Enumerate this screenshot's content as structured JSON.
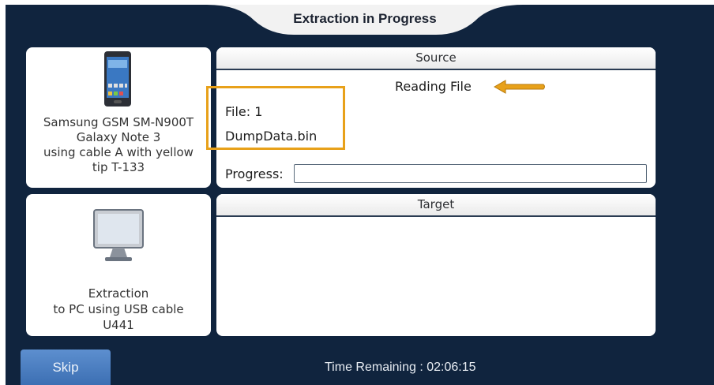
{
  "header": {
    "title": "Extraction in Progress"
  },
  "device": {
    "lines": [
      "Samsung GSM SM-N900T",
      "Galaxy Note 3",
      "using cable A with yellow",
      "tip T-133"
    ],
    "icon": "smartphone-icon"
  },
  "destination": {
    "lines": [
      "Extraction",
      "to PC using USB cable",
      "U441"
    ],
    "icon": "monitor-icon"
  },
  "source": {
    "header": "Source",
    "status": "Reading File",
    "file_label": "File:  1",
    "file_name": "DumpData.bin",
    "progress_label": "Progress:",
    "progress_value": 0,
    "annotation_arrow_icon": "left-arrow-icon",
    "annotation_color": "#e8a11a"
  },
  "target": {
    "header": "Target"
  },
  "footer": {
    "skip_label": "Skip",
    "time_remaining": "Time Remaining : 02:06:15"
  },
  "colors": {
    "background": "#10243e",
    "accent_button": "#4a7dc0",
    "highlight": "#e8a11a"
  }
}
